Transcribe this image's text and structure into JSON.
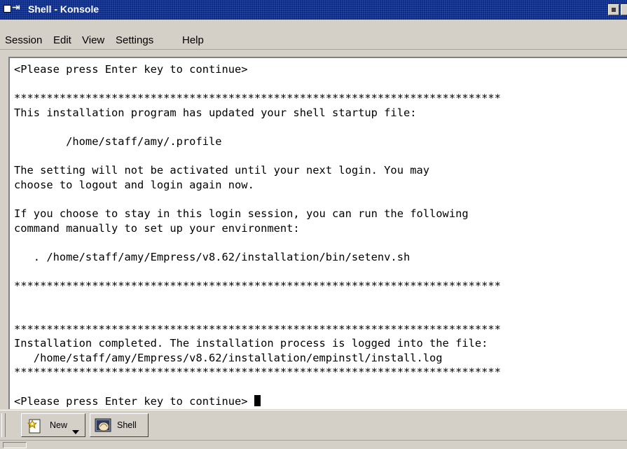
{
  "window": {
    "title": "Shell - Konsole",
    "titlebar_color": "#0a2a8a"
  },
  "menu": {
    "items": [
      "Session",
      "Edit",
      "View",
      "Settings",
      "Help"
    ]
  },
  "terminal": {
    "text": "<Please press Enter key to continue>\n\n***************************************************************************\nThis installation program has updated your shell startup file:\n\n        /home/staff/amy/.profile\n\nThe setting will not be activated until your next login. You may\nchoose to logout and login again now.\n\nIf you choose to stay in this login session, you can run the following\ncommand manually to set up your environment:\n\n   . /home/staff/amy/Empress/v8.62/installation/bin/setenv.sh\n\n***************************************************************************\n\n\n***************************************************************************\nInstallation completed. The installation process is logged into the file:\n   /home/staff/amy/Empress/v8.62/installation/empinstl/install.log\n***************************************************************************\n\n<Please press Enter key to continue>"
  },
  "taskbar": {
    "tabs": [
      {
        "label": "New",
        "icon": "new-session-icon"
      },
      {
        "label": "Shell",
        "icon": "shell-icon"
      }
    ]
  }
}
